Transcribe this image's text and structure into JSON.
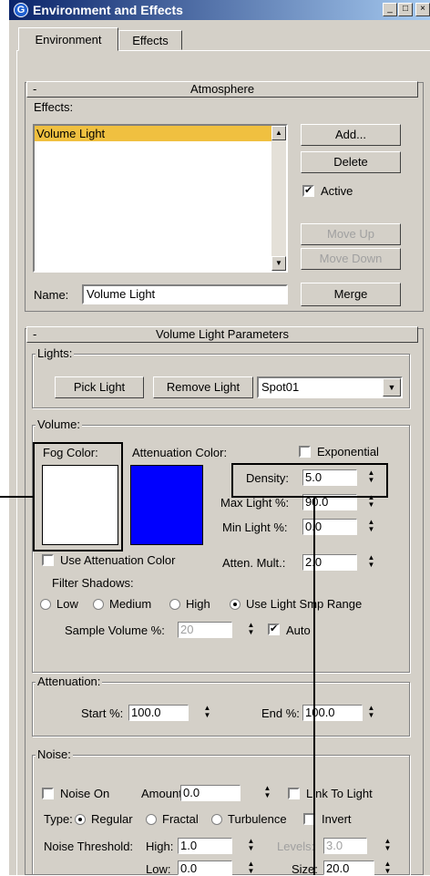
{
  "window": {
    "title": "Environment and Effects",
    "icon_label": "G",
    "controls": [
      "_",
      "□",
      "×"
    ]
  },
  "tabs": [
    {
      "label": "Environment",
      "active": true
    },
    {
      "label": "Effects",
      "active": false
    }
  ],
  "atmosphere": {
    "collapse": "-",
    "title": "Atmosphere",
    "effects_label": "Effects:",
    "effects_list": [
      "Volume Light"
    ],
    "buttons": {
      "add": "Add...",
      "delete": "Delete",
      "move_up": "Move Up",
      "move_down": "Move Down",
      "merge": "Merge"
    },
    "active": {
      "label": "Active",
      "checked": true
    },
    "name_label": "Name:",
    "name_value": "Volume Light"
  },
  "volume_light": {
    "collapse": "-",
    "title": "Volume Light Parameters",
    "lights": {
      "group": "Lights:",
      "pick_light": "Pick Light",
      "remove_light": "Remove Light",
      "light_select": "Spot01"
    },
    "volume": {
      "group": "Volume:",
      "fog_color_label": "Fog Color:",
      "fog_color": "#ffffff",
      "attenuation_color_label": "Attenuation Color:",
      "attenuation_color": "#0000ff",
      "exponential": {
        "label": "Exponential",
        "checked": false
      },
      "density": {
        "label": "Density:",
        "value": "5.0"
      },
      "max_light": {
        "label": "Max Light %:",
        "value": "90.0"
      },
      "min_light": {
        "label": "Min Light %:",
        "value": "0.0"
      },
      "use_attenuation_color": {
        "label": "Use Attenuation Color",
        "checked": false
      },
      "atten_mult": {
        "label": "Atten. Mult.:",
        "value": "2.0"
      },
      "filter_shadows_label": "Filter Shadows:",
      "filter_options": [
        {
          "label": "Low",
          "selected": false
        },
        {
          "label": "Medium",
          "selected": false
        },
        {
          "label": "High",
          "selected": false
        },
        {
          "label": "Use Light Smp Range",
          "selected": true
        }
      ],
      "sample_volume": {
        "label": "Sample Volume %:",
        "value": "20"
      },
      "auto": {
        "label": "Auto",
        "checked": true
      }
    },
    "attenuation": {
      "group": "Attenuation:",
      "start": {
        "label": "Start %:",
        "value": "100.0"
      },
      "end": {
        "label": "End %:",
        "value": "100.0"
      }
    },
    "noise": {
      "group": "Noise:",
      "noise_on": {
        "label": "Noise On",
        "checked": false
      },
      "amount": {
        "label": "Amount:",
        "value": "0.0"
      },
      "link_to_light": {
        "label": "Link To Light",
        "checked": false
      },
      "type_label": "Type:",
      "types": [
        {
          "label": "Regular",
          "selected": true
        },
        {
          "label": "Fractal",
          "selected": false
        },
        {
          "label": "Turbulence",
          "selected": false
        }
      ],
      "invert": {
        "label": "Invert",
        "checked": false
      },
      "threshold_label": "Noise Threshold:",
      "high": {
        "label": "High:",
        "value": "1.0"
      },
      "levels": {
        "label": "Levels:",
        "value": "3.0"
      },
      "low": {
        "label": "Low:",
        "value": "0.0"
      },
      "size": {
        "label": "Size:",
        "value": "20.0"
      }
    }
  },
  "colors": {
    "title_bar": "#0a246a",
    "selection": "#f0c040",
    "panel": "#d4d0c8"
  }
}
